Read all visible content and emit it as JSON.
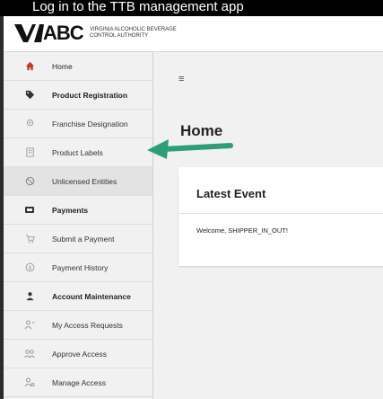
{
  "top_caption": "Log in to the TTB management app",
  "logo": {
    "mark": "VA",
    "abc": "ABC",
    "subtitle_line1": "VIRGINIA ALCOHOLIC BEVERAGE",
    "subtitle_line2": "CONTROL AUTHORITY"
  },
  "sidebar": {
    "items": [
      {
        "label": "Home",
        "icon": "home-icon",
        "type": "section"
      },
      {
        "label": "Product Registration",
        "icon": "tag-icon",
        "type": "section"
      },
      {
        "label": "Franchise Designation",
        "icon": "location-icon",
        "type": "sub"
      },
      {
        "label": "Product Labels",
        "icon": "document-icon",
        "type": "sub"
      },
      {
        "label": "Unlicensed Entities",
        "icon": "unlicensed-icon",
        "type": "sub",
        "active": true
      },
      {
        "label": "Payments",
        "icon": "payments-icon",
        "type": "section"
      },
      {
        "label": "Submit a Payment",
        "icon": "cart-icon",
        "type": "sub"
      },
      {
        "label": "Payment History",
        "icon": "dollar-circle-icon",
        "type": "sub"
      },
      {
        "label": "Account Maintenance",
        "icon": "person-icon",
        "type": "section"
      },
      {
        "label": "My Access Requests",
        "icon": "access-request-icon",
        "type": "sub"
      },
      {
        "label": "Approve Access",
        "icon": "approve-access-icon",
        "type": "sub"
      },
      {
        "label": "Manage Access",
        "icon": "manage-access-icon",
        "type": "sub"
      }
    ]
  },
  "main": {
    "menu_toggle": "≡",
    "title": "Home",
    "card": {
      "title": "Latest Event",
      "message": "Welcome, SHIPPER_IN_OUT!"
    }
  },
  "colors": {
    "arrow": "#2e9e78",
    "sidebar_bg": "#f1f1f1",
    "home_icon": "#c0392b"
  }
}
